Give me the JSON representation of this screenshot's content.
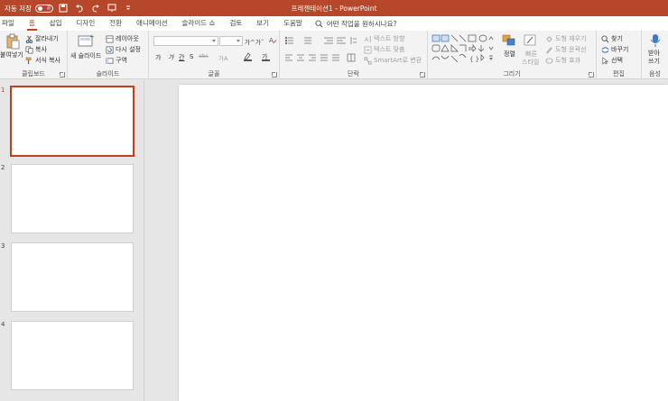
{
  "titlebar": {
    "autosave_label": "자동 저장",
    "autosave_state": "끔",
    "doc_title": "프레젠테이션1 - PowerPoint",
    "accent": "#b7472a"
  },
  "tabs": [
    "파일",
    "홈",
    "삽입",
    "디자인",
    "전환",
    "애니메이션",
    "슬라이드 쇼",
    "검토",
    "보기",
    "도움말"
  ],
  "active_tab": "홈",
  "search": {
    "text": "어떤 작업을 원하시나요?"
  },
  "ribbon": {
    "clipboard": {
      "label": "클립보드",
      "paste": "붙여넣기",
      "cut": "잘라내기",
      "copy": "복사",
      "format_painter": "서식 복사"
    },
    "slides": {
      "label": "슬라이드",
      "new_slide": "새 슬라이드",
      "layout": "레이아웃",
      "reset": "다시 설정",
      "section": "구역"
    },
    "font": {
      "label": "글꼴",
      "buttons": [
        "가",
        "가",
        "간",
        "S",
        "abc",
        "가A"
      ],
      "grow": "가^",
      "shrink": "가ˇ"
    },
    "paragraph": {
      "label": "단락",
      "text_direction": "텍스트 방향",
      "align_text": "텍스트 맞춤",
      "smartart": "SmartArt로 변환"
    },
    "drawing": {
      "label": "그리기",
      "arrange": "정렬",
      "quick_styles": [
        "빠른",
        "스타일"
      ],
      "shape_fill": "도형 채우기",
      "shape_outline": "도형 윤곽선",
      "shape_effects": "도형 효과"
    },
    "editing": {
      "label": "편집",
      "find": "찾기",
      "replace": "바꾸기",
      "select": "선택"
    },
    "voice": {
      "label": "음성",
      "dictate": [
        "받아",
        "쓰기"
      ]
    }
  },
  "slides": [
    {
      "number": "1",
      "active": true
    },
    {
      "number": "2",
      "active": false
    },
    {
      "number": "3",
      "active": false
    },
    {
      "number": "4",
      "active": false
    }
  ]
}
